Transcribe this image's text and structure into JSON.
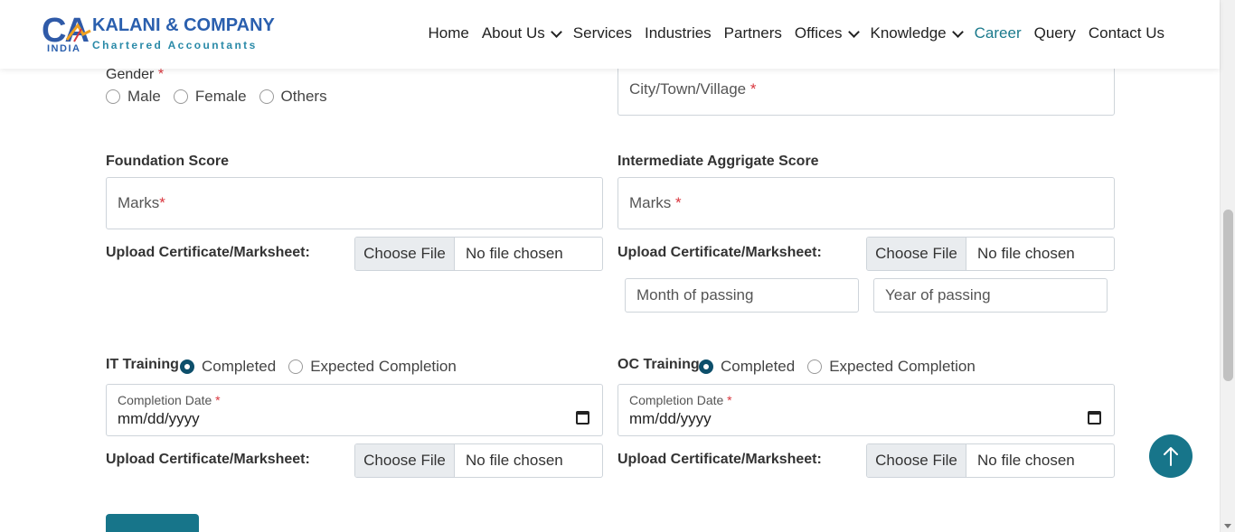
{
  "brand": {
    "logo_letters": "CA",
    "name": "KALANI & COMPANY",
    "tagline": "Chartered Accountants",
    "country": "INDIA"
  },
  "nav": {
    "items": [
      {
        "label": "Home",
        "dropdown": false,
        "active": false
      },
      {
        "label": "About Us",
        "dropdown": true,
        "active": false
      },
      {
        "label": "Services",
        "dropdown": false,
        "active": false
      },
      {
        "label": "Industries",
        "dropdown": false,
        "active": false
      },
      {
        "label": "Partners",
        "dropdown": false,
        "active": false
      },
      {
        "label": "Offices",
        "dropdown": true,
        "active": false
      },
      {
        "label": "Knowledge",
        "dropdown": true,
        "active": false
      },
      {
        "label": "Career",
        "dropdown": false,
        "active": true
      },
      {
        "label": "Query",
        "dropdown": false,
        "active": false
      },
      {
        "label": "Contact Us",
        "dropdown": false,
        "active": false
      }
    ]
  },
  "form": {
    "gender": {
      "label": "Gender",
      "required_mark": "*",
      "options": [
        "Male",
        "Female",
        "Others"
      ]
    },
    "city": {
      "placeholder": "City/Town/Village",
      "required_mark": "*"
    },
    "foundation": {
      "label": "Foundation Score",
      "marks_placeholder": "Marks",
      "required_mark": "*",
      "upload_label": "Upload Certificate/Marksheet:"
    },
    "intermediate": {
      "label": "Intermediate Aggrigate Score",
      "marks_placeholder": "Marks",
      "required_mark": "*",
      "upload_label": "Upload Certificate/Marksheet:",
      "month_placeholder": "Month of passing",
      "year_placeholder": "Year of passing"
    },
    "it_training": {
      "label": "IT Training",
      "options": [
        "Completed",
        "Expected Completion"
      ],
      "selected": "Completed",
      "date_label": "Completion Date",
      "required_mark": "*",
      "date_value": "mm/dd/yyyy",
      "upload_label": "Upload Certificate/Marksheet:"
    },
    "oc_training": {
      "label": "OC Training",
      "options": [
        "Completed",
        "Expected Completion"
      ],
      "selected": "Completed",
      "date_label": "Completion Date",
      "required_mark": "*",
      "date_value": "mm/dd/yyyy",
      "upload_label": "Upload Certificate/Marksheet:"
    },
    "file_input": {
      "button_label": "Choose File",
      "status": "No file chosen"
    }
  },
  "colors": {
    "accent": "#17758a",
    "brand_blue": "#2a5fae",
    "required": "#d9363e",
    "radio_checked": "#0d4f6b"
  },
  "icons": {
    "scroll_top": "arrow-up-icon",
    "date": "calendar-icon",
    "dropdown": "chevron-down-icon"
  }
}
